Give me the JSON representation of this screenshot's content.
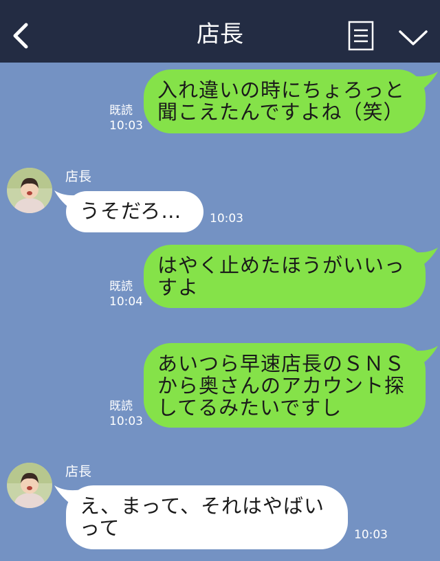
{
  "header": {
    "title": "店長",
    "back_icon": "chevron-left-icon",
    "menu_icon": "menu-icon",
    "collapse_icon": "chevron-down-icon",
    "background": "#232c43"
  },
  "chat": {
    "background": "#7492c3",
    "sent_color": "#85e249",
    "received_color": "#ffffff",
    "messages": [
      {
        "direction": "sent",
        "text": "入れ違いの時にちょろっと\n聞こえたんですよね（笑）",
        "read": "既読",
        "time": "10:03"
      },
      {
        "direction": "received",
        "sender": "店長",
        "text": "うそだろ…",
        "time": "10:03"
      },
      {
        "direction": "sent",
        "text": "はやく止めたほうがいいっ\nすよ",
        "read": "既読",
        "time": "10:04"
      },
      {
        "direction": "sent",
        "text": "あいつら早速店長のＳＮＳ\nから奥さんのアカウント探\nしてるみたいですし",
        "read": "既読",
        "time": "10:03"
      },
      {
        "direction": "received",
        "sender": "店長",
        "text": "え、まって、それはやばい\nって",
        "time": "10:03"
      }
    ]
  }
}
